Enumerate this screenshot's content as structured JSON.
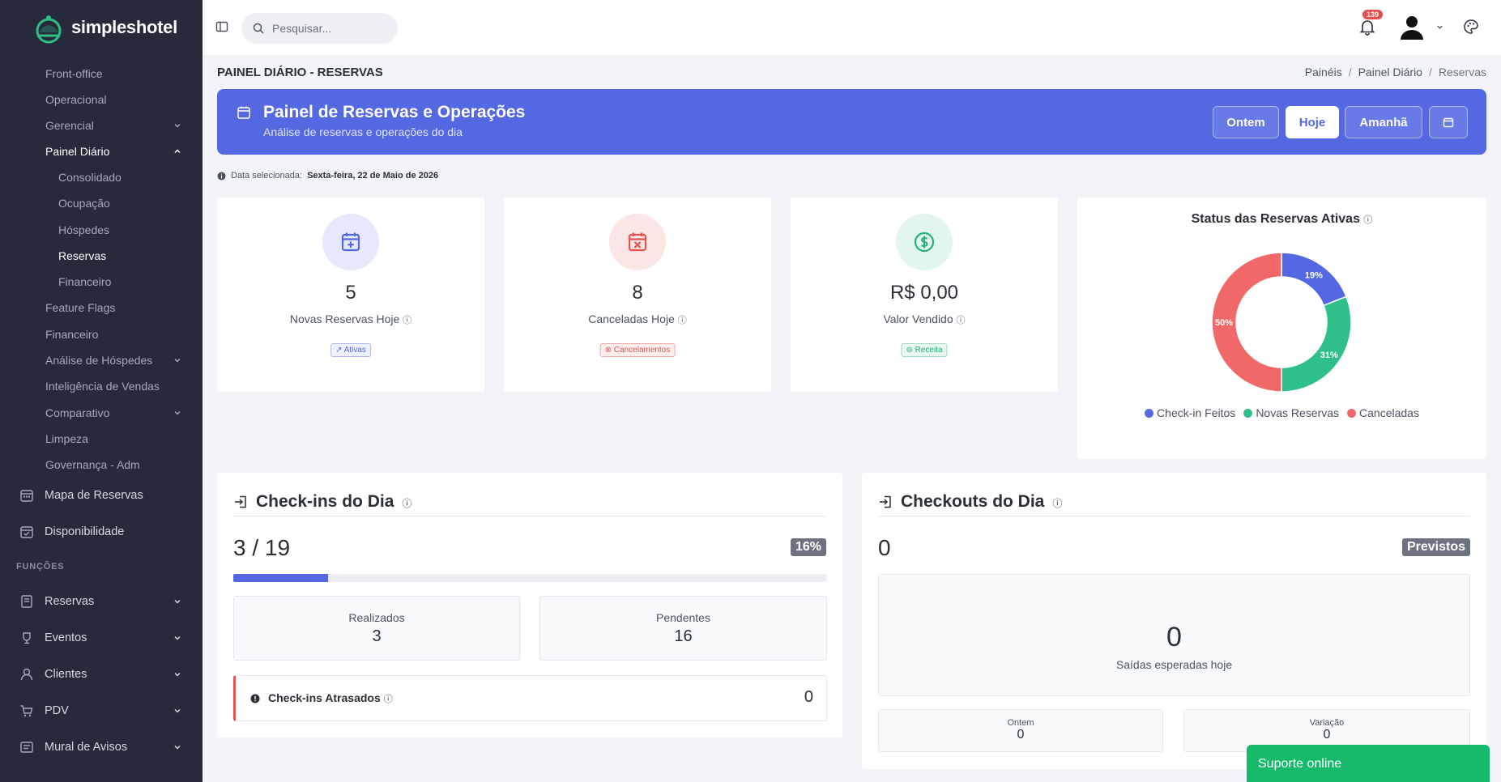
{
  "brand": {
    "name": "simpleshotel"
  },
  "sidebar": {
    "sub_items": [
      {
        "label": "Front-office"
      },
      {
        "label": "Operacional"
      },
      {
        "label": "Gerencial"
      },
      {
        "label": "Painel Diário"
      },
      {
        "label": "Consolidado"
      },
      {
        "label": "Ocupação"
      },
      {
        "label": "Hóspedes"
      },
      {
        "label": "Reservas"
      },
      {
        "label": "Financeiro"
      },
      {
        "label": "Feature Flags"
      },
      {
        "label": "Financeiro"
      },
      {
        "label": "Análise de Hóspedes"
      },
      {
        "label": "Inteligência de Vendas"
      },
      {
        "label": "Comparativo"
      },
      {
        "label": "Limpeza"
      },
      {
        "label": "Governança - Adm"
      }
    ],
    "main_items": [
      {
        "label": "Mapa de Reservas",
        "icon": "calendar-grid-icon"
      },
      {
        "label": "Disponibilidade",
        "icon": "calendar-check-icon"
      }
    ],
    "section_title": "FUNÇÕES",
    "func_items": [
      {
        "label": "Reservas",
        "icon": "book-icon"
      },
      {
        "label": "Eventos",
        "icon": "trophy-icon"
      },
      {
        "label": "Clientes",
        "icon": "user-icon"
      },
      {
        "label": "PDV",
        "icon": "cart-icon"
      },
      {
        "label": "Mural de Avisos",
        "icon": "notice-board-icon"
      }
    ]
  },
  "topbar": {
    "search_placeholder": "Pesquisar...",
    "notification_count": "139"
  },
  "page": {
    "title": "PAINEL DIÁRIO - RESERVAS",
    "breadcrumb": [
      "Painéis",
      "Painel Diário",
      "Reservas"
    ]
  },
  "banner": {
    "title": "Painel de Reservas e Operações",
    "subtitle": "Análise de reservas e operações do dia",
    "buttons": [
      "Ontem",
      "Hoje",
      "Amanhã"
    ],
    "selected": "Hoje"
  },
  "date_info": {
    "prefix": "Data selecionada:",
    "date": "Sexta-feira, 22 de Maio de 2026"
  },
  "stats": [
    {
      "value": "5",
      "label": "Novas Reservas Hoje",
      "tag": "Ativas",
      "color": "#5468e2"
    },
    {
      "value": "8",
      "label": "Canceladas Hoje",
      "tag": "Cancelamentos",
      "color": "#e55353"
    },
    {
      "value": "R$ 0,00",
      "label": "Valor Vendido",
      "tag": "Receita",
      "color": "#20b27a"
    }
  ],
  "donut": {
    "title": "Status das Reservas Ativas"
  },
  "chart_data": {
    "type": "pie",
    "title": "Status das Reservas Ativas",
    "categories": [
      "Check-in Feitos",
      "Novas Reservas",
      "Canceladas"
    ],
    "values": [
      19,
      31,
      50
    ],
    "labels": [
      "19%",
      "31%",
      "50%"
    ],
    "colors": [
      "#5468e2",
      "#2fc08a",
      "#f06868"
    ],
    "legend": "bottom"
  },
  "checkins": {
    "title": "Check-ins do Dia",
    "count": "3 / 19",
    "percent": "16%",
    "progress": 0.16,
    "done_label": "Realizados",
    "done_value": "3",
    "pending_label": "Pendentes",
    "pending_value": "16",
    "late_label": "Check-ins Atrasados",
    "late_value": "0"
  },
  "checkouts": {
    "title": "Checkouts do Dia",
    "count": "0",
    "badge": "Previstos",
    "expected_value": "0",
    "expected_label": "Saídas esperadas hoje",
    "yesterday_label": "Ontem",
    "yesterday_value": "0",
    "variation_label": "Variação",
    "variation_value": "0"
  },
  "support": {
    "label": "Suporte online"
  }
}
